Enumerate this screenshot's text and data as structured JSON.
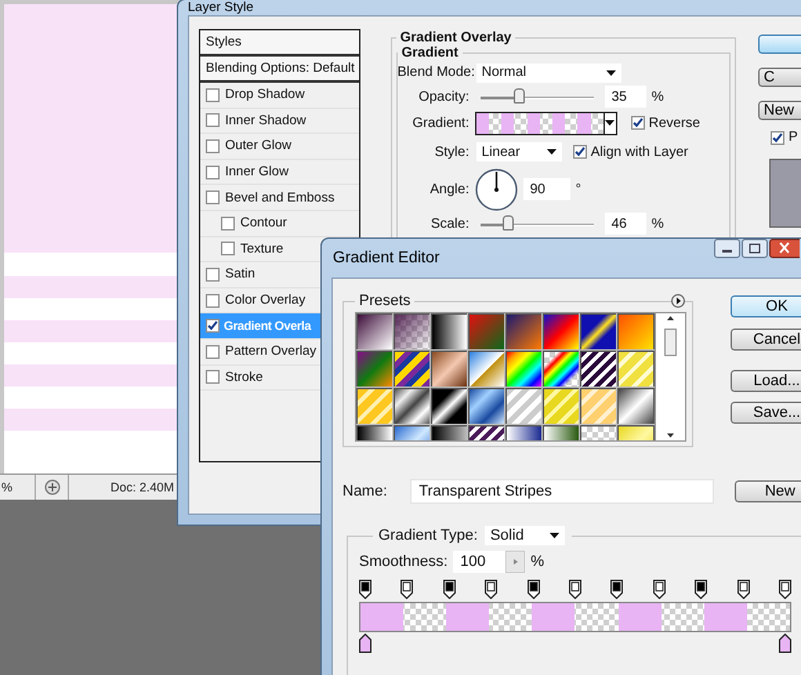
{
  "document": {
    "status": {
      "zoom": "%",
      "doc_size": "Doc: 2.40M"
    }
  },
  "layer_style": {
    "title": "Layer Style",
    "styles_header": "Styles",
    "blending_options": "Blending Options: Default",
    "styles": [
      {
        "label": "Drop Shadow",
        "checked": false,
        "selected": false
      },
      {
        "label": "Inner Shadow",
        "checked": false,
        "selected": false
      },
      {
        "label": "Outer Glow",
        "checked": false,
        "selected": false
      },
      {
        "label": "Inner Glow",
        "checked": false,
        "selected": false
      },
      {
        "label": "Bevel and Emboss",
        "checked": false,
        "selected": false,
        "children": [
          {
            "label": "Contour",
            "checked": false,
            "selected": false
          },
          {
            "label": "Texture",
            "checked": false,
            "selected": false
          }
        ]
      },
      {
        "label": "Satin",
        "checked": false,
        "selected": false
      },
      {
        "label": "Color Overlay",
        "checked": false,
        "selected": false
      },
      {
        "label": "Gradient Overla",
        "checked": true,
        "selected": true
      },
      {
        "label": "Pattern Overlay",
        "checked": false,
        "selected": false
      },
      {
        "label": "Stroke",
        "checked": false,
        "selected": false
      }
    ],
    "gradient_overlay": {
      "title": "Gradient Overlay",
      "group": "Gradient",
      "blend_mode": {
        "label": "Blend Mode:",
        "value": "Normal"
      },
      "opacity": {
        "label": "Opacity:",
        "level": 0.35,
        "value": "35",
        "unit": "%"
      },
      "gradient": {
        "label": "Gradient:"
      },
      "reverse": {
        "label": "Reverse",
        "checked": true
      },
      "style": {
        "label": "Style:",
        "value": "Linear"
      },
      "align": {
        "label": "Align with Layer",
        "checked": true
      },
      "angle": {
        "label": "Angle:",
        "value": "90",
        "unit": "°"
      },
      "scale": {
        "label": "Scale:",
        "level": 0.25,
        "value": "46",
        "unit": "%"
      }
    },
    "buttons": [
      {
        "kind": "default"
      },
      {
        "kind": "plain",
        "label": "C"
      },
      {
        "kind": "plain",
        "label": "New"
      }
    ],
    "preview": {
      "label": "P",
      "checked": true
    }
  },
  "gradient_editor": {
    "title": "Gradient Editor",
    "presets_title": "Presets",
    "buttons": [
      "OK",
      "Cancel",
      "Load...",
      "Save..."
    ],
    "name": {
      "label": "Name:",
      "value": "Transparent Stripes"
    },
    "new_button": "New",
    "gradient_type": {
      "label": "Gradient Type:",
      "value": "Solid"
    },
    "smoothness": {
      "label": "Smoothness:",
      "value": "100",
      "unit": "%"
    },
    "opacity_stops": [
      {
        "opaque": true
      },
      {
        "opaque": false
      },
      {
        "opaque": true
      },
      {
        "opaque": false
      },
      {
        "opaque": true
      },
      {
        "opaque": false
      },
      {
        "opaque": true
      },
      {
        "opaque": false
      },
      {
        "opaque": true
      },
      {
        "opaque": false
      },
      {
        "opaque": false
      }
    ],
    "color_stops": [
      {
        "color": "#e8b4f4"
      },
      {
        "color": "#e8b4f4"
      }
    ]
  }
}
